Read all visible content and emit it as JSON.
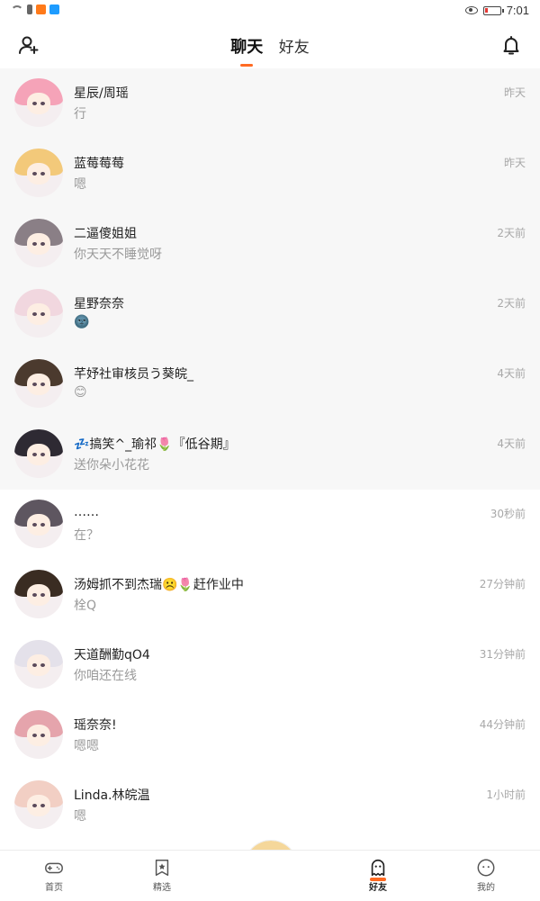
{
  "status_bar": {
    "time": "7:01"
  },
  "top_nav": {
    "tabs": [
      {
        "label": "聊天",
        "active": true
      },
      {
        "label": "好友",
        "active": false
      }
    ],
    "left_icon": "add-user-icon",
    "right_icon": "bell-icon"
  },
  "conversations": [
    {
      "name": "星辰/周瑶",
      "message": "行",
      "time": "昨天",
      "pinned": true,
      "hair": "#f5a3b8"
    },
    {
      "name": "蓝莓莓莓",
      "message": "嗯",
      "time": "昨天",
      "pinned": true,
      "hair": "#f3c97a"
    },
    {
      "name": "二逼傻姐姐",
      "message": "你天天不睡觉呀",
      "time": "2天前",
      "pinned": true,
      "hair": "#8a7f86"
    },
    {
      "name": "星野奈奈",
      "message": "🌚",
      "time": "2天前",
      "pinned": true,
      "hair": "#f1d7df"
    },
    {
      "name": "芊妤社审核员う葵皖_",
      "message": "😊",
      "time": "4天前",
      "pinned": true,
      "hair": "#4b3a2e"
    },
    {
      "name": "💤搞笑^_瑜祁🌷『低谷期』",
      "message": "送你朵小花花",
      "time": "4天前",
      "pinned": true,
      "hair": "#2e2a33"
    },
    {
      "name": "……",
      "message": "在？",
      "time": "30秒前",
      "pinned": false,
      "hair": "#5e5660"
    },
    {
      "name": "汤姆抓不到杰瑞☹️🌷赶作业中",
      "message": "栓Q",
      "time": "27分钟前",
      "pinned": false,
      "hair": "#3a2c22"
    },
    {
      "name": "天道酬勤qO4",
      "message": "你咱还在线",
      "time": "31分钟前",
      "pinned": false,
      "hair": "#e4e1ea"
    },
    {
      "name": "瑶奈奈!",
      "message": "嗯嗯",
      "time": "44分钟前",
      "pinned": false,
      "hair": "#e5a4ac"
    },
    {
      "name": "Linda.林皖温",
      "message": "嗯",
      "time": "1小时前",
      "pinned": false,
      "hair": "#f2cfc4"
    }
  ],
  "bottom_nav": [
    {
      "label": "首页",
      "icon": "gamepad-icon",
      "active": false
    },
    {
      "label": "精选",
      "icon": "star-bookmark-icon",
      "active": false
    },
    {
      "label": "",
      "icon": "profile-avatar",
      "active": false
    },
    {
      "label": "好友",
      "icon": "ghost-icon",
      "active": true
    },
    {
      "label": "我的",
      "icon": "face-icon",
      "active": false
    }
  ],
  "colors": {
    "accent": "#ff6a22",
    "pinned_bg": "#f7f7f7",
    "time_text": "#a8a8a8",
    "message_text": "#9a9a9a"
  }
}
